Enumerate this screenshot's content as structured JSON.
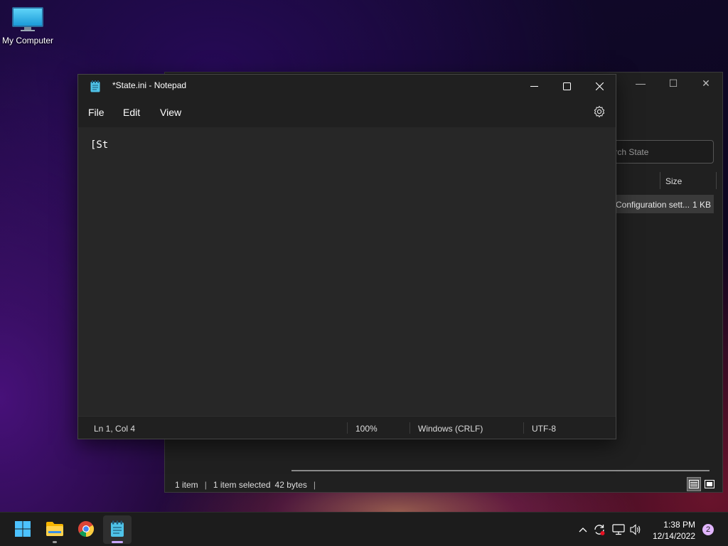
{
  "desktop": {
    "icons": [
      {
        "label": "My Computer",
        "icon": "monitor-icon"
      }
    ]
  },
  "explorer": {
    "search_placeholder": "Search State",
    "columns": {
      "size": "Size"
    },
    "rows": [
      {
        "type": "Configuration sett...",
        "size": "1 KB"
      }
    ],
    "status": {
      "items": "1 item",
      "selected": "1 item selected",
      "bytes": "42 bytes"
    }
  },
  "notepad": {
    "title": "*State.ini - Notepad",
    "menu": [
      "File",
      "Edit",
      "View"
    ],
    "content": "[St",
    "status": {
      "position": "Ln 1, Col 4",
      "zoom": "100%",
      "line_ending": "Windows (CRLF)",
      "encoding": "UTF-8"
    }
  },
  "taskbar": {
    "apps": [
      {
        "name": "start",
        "icon": "windows-logo-icon"
      },
      {
        "name": "file-explorer",
        "icon": "folder-icon"
      },
      {
        "name": "chrome",
        "icon": "chrome-icon"
      },
      {
        "name": "notepad",
        "icon": "notepad-icon"
      }
    ],
    "time": "1:38 PM",
    "date": "12/14/2022",
    "notification_count": "2"
  },
  "colors": {
    "accent_notif": "#e2b6ff",
    "window_bg": "#272727",
    "titlebar_bg": "#202020"
  }
}
